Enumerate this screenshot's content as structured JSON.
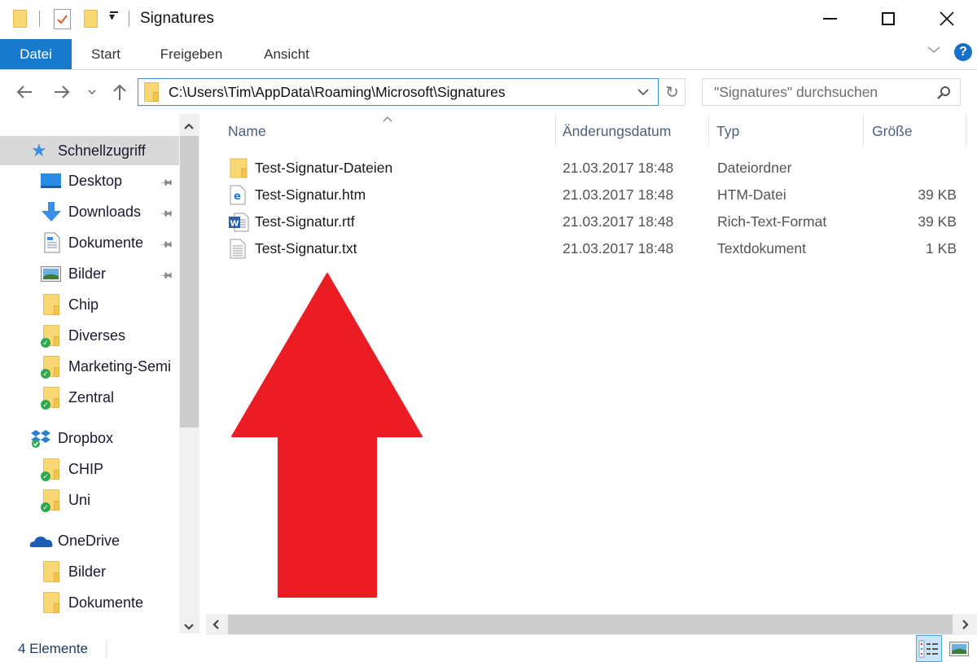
{
  "window": {
    "title": "Signatures",
    "controls": {
      "minimize": "minimize-icon",
      "maximize": "maximize-icon",
      "close": "close-icon"
    }
  },
  "ribbon": {
    "tabs": [
      {
        "label": "Datei",
        "active": true
      },
      {
        "label": "Start"
      },
      {
        "label": "Freigeben"
      },
      {
        "label": "Ansicht"
      }
    ],
    "expand_icon": "chevron-down-icon",
    "help_icon": "help-icon"
  },
  "address": {
    "path": "C:\\Users\\Tim\\AppData\\Roaming\\Microsoft\\Signatures",
    "search_placeholder": "\"Signatures\" durchsuchen"
  },
  "nav": {
    "items": [
      {
        "label": "Schnellzugriff",
        "icon": "star-icon",
        "selected": true
      },
      {
        "label": "Desktop",
        "icon": "desktop-icon",
        "pinned": true
      },
      {
        "label": "Downloads",
        "icon": "download-icon",
        "pinned": true
      },
      {
        "label": "Dokumente",
        "icon": "documents-icon",
        "pinned": true
      },
      {
        "label": "Bilder",
        "icon": "pictures-icon",
        "pinned": true
      },
      {
        "label": "Chip",
        "icon": "folder-icon"
      },
      {
        "label": "Diverses",
        "icon": "folder-synced-icon"
      },
      {
        "label": "Marketing-Semi",
        "icon": "folder-synced-icon"
      },
      {
        "label": "Zentral",
        "icon": "folder-synced-icon"
      },
      {
        "label": "Dropbox",
        "icon": "dropbox-icon"
      },
      {
        "label": "CHIP",
        "icon": "folder-synced-icon"
      },
      {
        "label": "Uni",
        "icon": "folder-synced-icon"
      },
      {
        "label": "OneDrive",
        "icon": "onedrive-icon"
      },
      {
        "label": "Bilder",
        "icon": "folder-icon"
      },
      {
        "label": "Dokumente",
        "icon": "folder-icon"
      }
    ]
  },
  "files": {
    "columns": [
      "Name",
      "Änderungsdatum",
      "Typ",
      "Größe"
    ],
    "rows": [
      {
        "name": "Test-Signatur-Dateien",
        "date": "21.03.2017 18:48",
        "type": "Dateiordner",
        "size": "",
        "icon": "folder-icon"
      },
      {
        "name": "Test-Signatur.htm",
        "date": "21.03.2017 18:48",
        "type": "HTM-Datei",
        "size": "39 KB",
        "icon": "edge-html-icon"
      },
      {
        "name": "Test-Signatur.rtf",
        "date": "21.03.2017 18:48",
        "type": "Rich-Text-Format",
        "size": "39 KB",
        "icon": "word-doc-icon"
      },
      {
        "name": "Test-Signatur.txt",
        "date": "21.03.2017 18:48",
        "type": "Textdokument",
        "size": "1 KB",
        "icon": "text-file-icon"
      }
    ]
  },
  "annotation": {
    "type": "arrow-up",
    "color": "#ec1c24"
  },
  "status": {
    "count": "4 Elemente"
  },
  "colors": {
    "accent": "#1979ca",
    "arrow": "#ec1c24",
    "folder": "#f8d775"
  }
}
